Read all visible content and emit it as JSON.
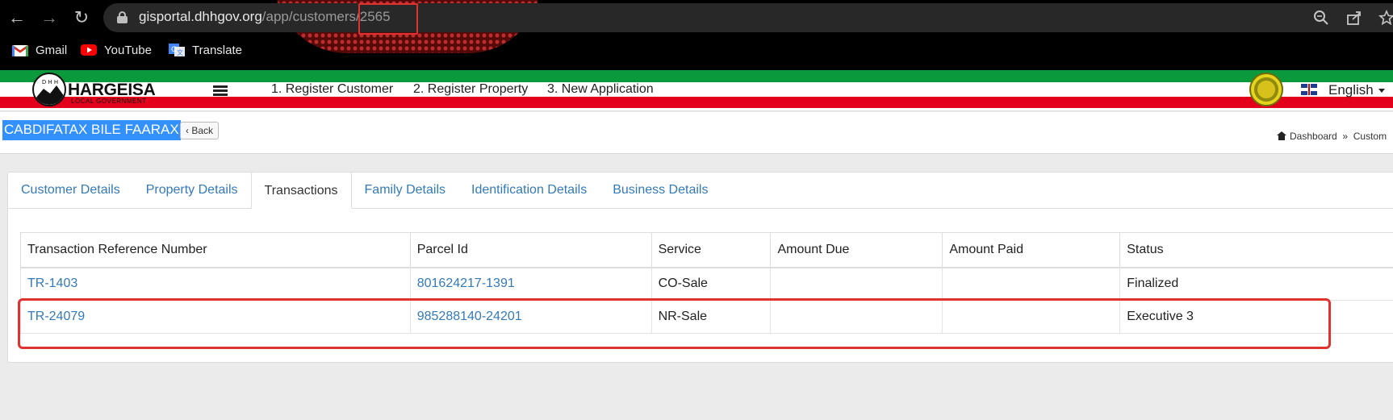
{
  "browser": {
    "url_host": "gisportal.dhhgov.org",
    "url_path": "/app/customers/2565",
    "bookmarks": [
      {
        "label": "Gmail",
        "icon": "gmail-icon"
      },
      {
        "label": "YouTube",
        "icon": "youtube-icon"
      },
      {
        "label": "Translate",
        "icon": "translate-icon"
      }
    ]
  },
  "app": {
    "logo_title": "HARGEISA",
    "logo_subtitle": "LOCAL GOVERNMENT",
    "logo_letters": "D H H",
    "nav": [
      "1. Register Customer",
      "2. Register Property",
      "3. New Application"
    ],
    "language": "English"
  },
  "page": {
    "customer_name": "CABDIFATAX BILE FAARAX",
    "back_label": "Back",
    "breadcrumb": [
      "Dashboard",
      "Custom"
    ]
  },
  "tabs": [
    {
      "label": "Customer Details",
      "active": false
    },
    {
      "label": "Property Details",
      "active": false
    },
    {
      "label": "Transactions",
      "active": true
    },
    {
      "label": "Family Details",
      "active": false
    },
    {
      "label": "Identification Details",
      "active": false
    },
    {
      "label": "Business Details",
      "active": false
    }
  ],
  "transactions": {
    "columns": [
      "Transaction Reference Number",
      "Parcel Id",
      "Service",
      "Amount Due",
      "Amount Paid",
      "Status"
    ],
    "rows": [
      {
        "ref": "TR-1403",
        "parcel": "801624217-1391",
        "service": "CO-Sale",
        "due": "",
        "paid": "",
        "status": "Finalized"
      },
      {
        "ref": "TR-24079",
        "parcel": "985288140-24201",
        "service": "NR-Sale",
        "due": "",
        "paid": "",
        "status": "Executive 3"
      }
    ]
  },
  "colors": {
    "link": "#337ab7",
    "green_stripe": "#0a9a3b",
    "red_stripe": "#e2001a",
    "highlight": "#e0322f",
    "selection": "#3390ff"
  }
}
